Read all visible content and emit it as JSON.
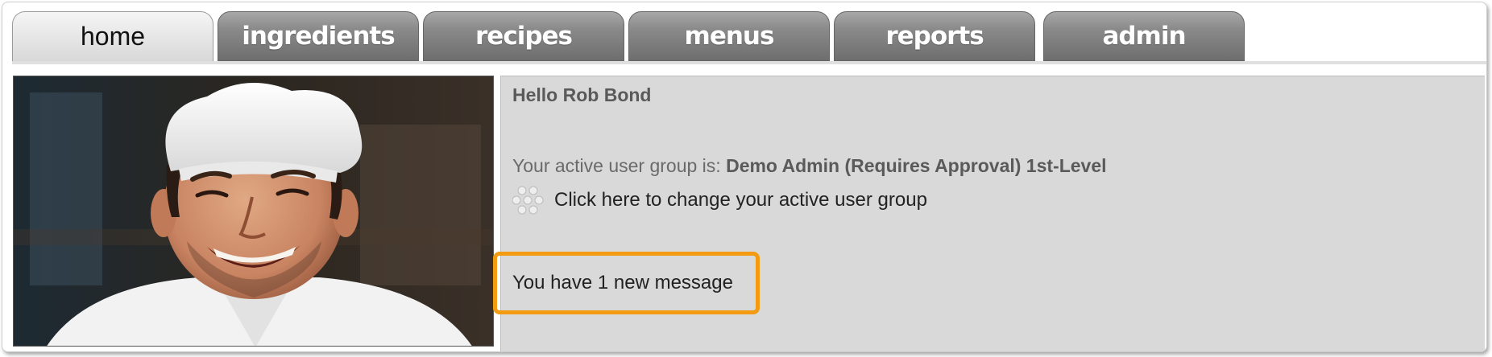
{
  "tabs": [
    {
      "label": "home",
      "active": true
    },
    {
      "label": "ingredients",
      "active": false
    },
    {
      "label": "recipes",
      "active": false
    },
    {
      "label": "menus",
      "active": false
    },
    {
      "label": "reports",
      "active": false
    },
    {
      "label": "admin",
      "active": false
    }
  ],
  "panel": {
    "greeting": "Hello Rob Bond",
    "group_prefix": "Your active user group is:",
    "group_name": "Demo Admin (Requires Approval) 1st-Level",
    "change_group_link": "Click here to change your active user group",
    "message_notice": "You have 1 new message",
    "highlight_color": "#f39c12"
  },
  "icons": {
    "change_group": "user-group-dots-icon"
  }
}
